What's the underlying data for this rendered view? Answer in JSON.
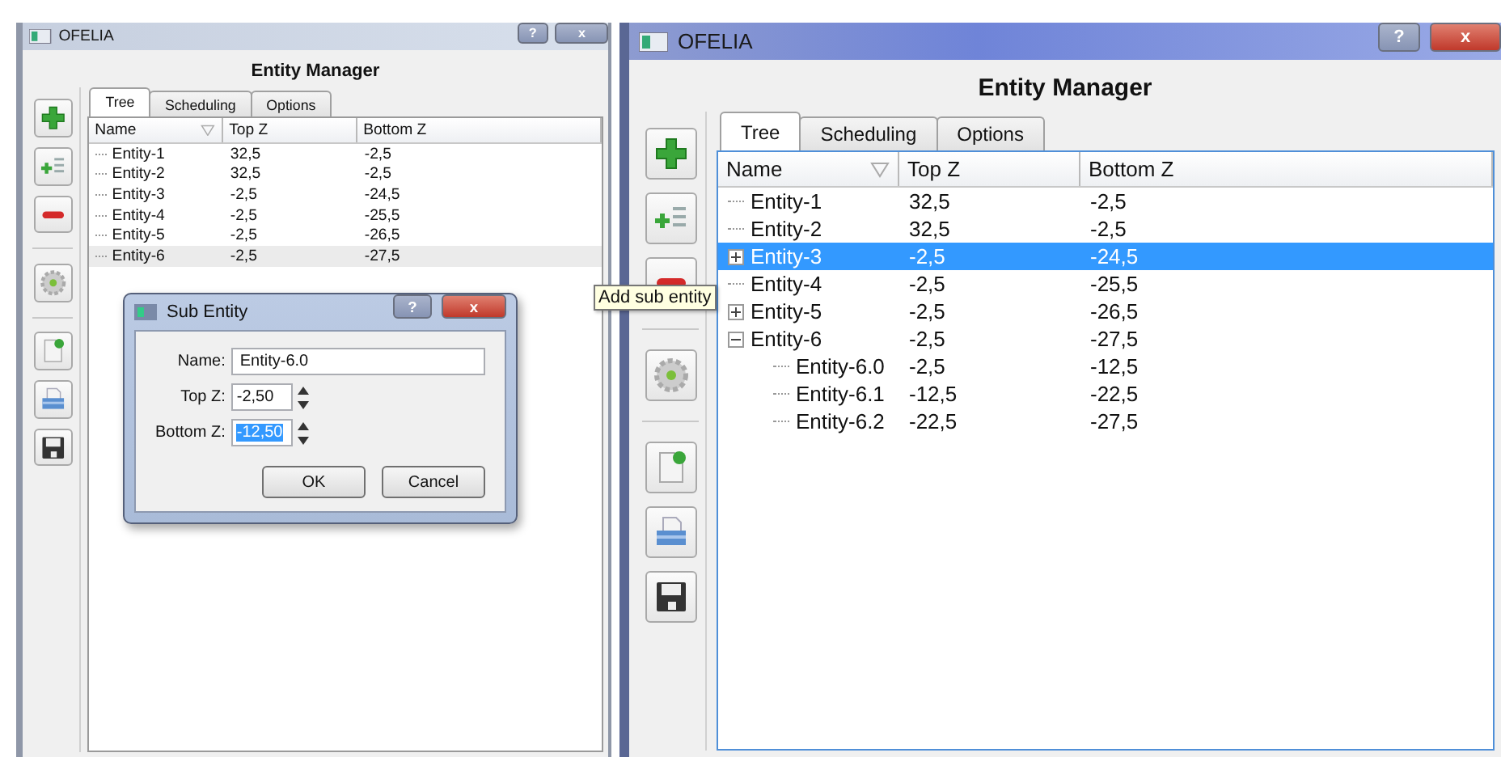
{
  "windows": [
    {
      "title": "OFELIA",
      "active": false,
      "title_buttons": [
        "?",
        "x"
      ],
      "heading": "Entity Manager",
      "tabs": [
        {
          "label": "Tree",
          "selected": true
        },
        {
          "label": "Scheduling",
          "selected": false
        },
        {
          "label": "Options",
          "selected": false
        }
      ],
      "columns": [
        "Name",
        "Top Z",
        "Bottom Z"
      ],
      "rows": [
        {
          "name": "Entity-1",
          "top_z": "32,5",
          "bottom_z": "-2,5",
          "selected": false
        },
        {
          "name": "Entity-2",
          "top_z": "32,5",
          "bottom_z": "-2,5",
          "selected": false
        },
        {
          "name": "Entity-3",
          "top_z": "-2,5",
          "bottom_z": "-24,5",
          "selected": false
        },
        {
          "name": "Entity-4",
          "top_z": "-2,5",
          "bottom_z": "-25,5",
          "selected": false
        },
        {
          "name": "Entity-5",
          "top_z": "-2,5",
          "bottom_z": "-26,5",
          "selected": false
        },
        {
          "name": "Entity-6",
          "top_z": "-2,5",
          "bottom_z": "-27,5",
          "selected": true
        }
      ],
      "dialog": {
        "title": "Sub Entity",
        "title_buttons": [
          "?",
          "x"
        ],
        "fields": [
          {
            "kind": "text",
            "label": "Name:",
            "value": "Entity-6.0",
            "selected": false
          },
          {
            "kind": "spin",
            "label": "Top Z:",
            "value": "-2,50",
            "selected": false
          },
          {
            "kind": "spin",
            "label": "Bottom Z:",
            "value": "-12,50",
            "selected": true
          }
        ],
        "buttons": [
          "OK",
          "Cancel"
        ]
      }
    },
    {
      "title": "OFELIA",
      "active": true,
      "title_buttons": [
        "?",
        "x"
      ],
      "heading": "Entity Manager",
      "tabs": [
        {
          "label": "Tree",
          "selected": true
        },
        {
          "label": "Scheduling",
          "selected": false
        },
        {
          "label": "Options",
          "selected": false
        }
      ],
      "columns": [
        "Name",
        "Top Z",
        "Bottom Z"
      ],
      "rows": [
        {
          "name": "Entity-1",
          "top_z": "32,5",
          "bottom_z": "-2,5",
          "selected": false
        },
        {
          "name": "Entity-2",
          "top_z": "32,5",
          "bottom_z": "-2,5",
          "selected": false
        },
        {
          "name": "Entity-3",
          "top_z": "-2,5",
          "bottom_z": "-24,5",
          "selected": true,
          "expanded": false
        },
        {
          "name": "Entity-4",
          "top_z": "-2,5",
          "bottom_z": "-25,5",
          "selected": false
        },
        {
          "name": "Entity-5",
          "top_z": "-2,5",
          "bottom_z": "-26,5",
          "selected": false,
          "expanded": false
        },
        {
          "name": "Entity-6",
          "top_z": "-2,5",
          "bottom_z": "-27,5",
          "selected": false,
          "expanded": true,
          "children": [
            {
              "name": "Entity-6.0",
              "top_z": "-2,5",
              "bottom_z": "-12,5",
              "selected": false
            },
            {
              "name": "Entity-6.1",
              "top_z": "-12,5",
              "bottom_z": "-22,5",
              "selected": false
            },
            {
              "name": "Entity-6.2",
              "top_z": "-22,5",
              "bottom_z": "-27,5",
              "selected": false
            }
          ]
        }
      ],
      "tooltip": "Add sub entity"
    }
  ]
}
